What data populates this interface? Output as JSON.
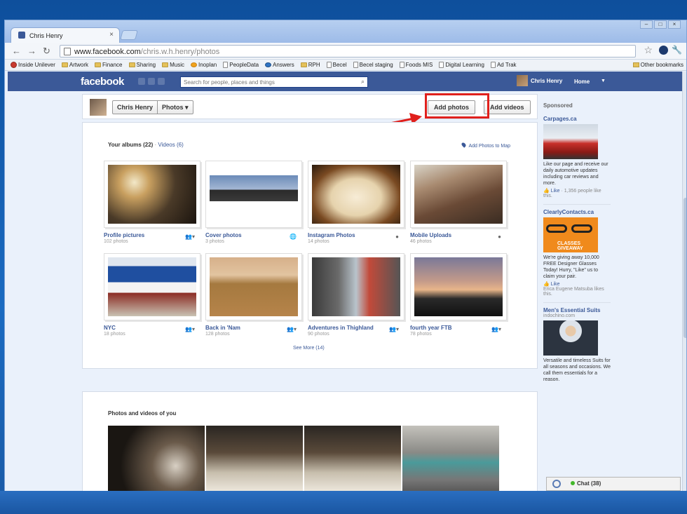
{
  "browser": {
    "tab_title": "Chris Henry",
    "url_host": "www.facebook.com",
    "url_path": "/chris.w.h.henry/photos",
    "bookmarks": [
      {
        "label": "Inside Unilever",
        "icon": "red-circle-icon"
      },
      {
        "label": "Artwork",
        "icon": "folder-icon"
      },
      {
        "label": "Finance",
        "icon": "folder-icon"
      },
      {
        "label": "Sharing",
        "icon": "folder-icon"
      },
      {
        "label": "Music",
        "icon": "folder-icon"
      },
      {
        "label": "Inoplan",
        "icon": "orange-circle-icon"
      },
      {
        "label": "PeopleData",
        "icon": "page-icon"
      },
      {
        "label": "Answers",
        "icon": "blue-circle-icon"
      },
      {
        "label": "RPH",
        "icon": "folder-icon"
      },
      {
        "label": "Becel",
        "icon": "page-icon"
      },
      {
        "label": "Becel staging",
        "icon": "page-icon"
      },
      {
        "label": "Foods MIS",
        "icon": "page-icon"
      },
      {
        "label": "Digital Learning",
        "icon": "page-icon"
      },
      {
        "label": "Ad Trak",
        "icon": "page-icon"
      }
    ],
    "other_bookmarks": "Other bookmarks"
  },
  "facebook": {
    "logo": "facebook",
    "search_placeholder": "Search for people, places and things",
    "user_name": "Chris Henry",
    "home": "Home"
  },
  "header": {
    "name": "Chris Henry",
    "section": "Photos ▾",
    "add_photos": "Add photos",
    "add_videos": "Add videos"
  },
  "albums": {
    "title": "Your albums (22)",
    "separator": " · ",
    "videos_link": "Videos (6)",
    "map_link": "Add Photos to Map",
    "items": [
      {
        "name": "Profile pictures",
        "count": "102 photos",
        "privacy": "👥▾"
      },
      {
        "name": "Cover photos",
        "count": "3 photos",
        "privacy": "🌐"
      },
      {
        "name": "Instagram Photos",
        "count": "14 photos",
        "privacy": "●"
      },
      {
        "name": "Mobile Uploads",
        "count": "46 photos",
        "privacy": "●"
      },
      {
        "name": "NYC",
        "count": "18 photos",
        "privacy": "👥▾"
      },
      {
        "name": "Back in 'Nam",
        "count": "128 photos",
        "privacy": "👥▾"
      },
      {
        "name": "Adventures in Thighland",
        "count": "90 photos",
        "privacy": "👥▾"
      },
      {
        "name": "fourth year FTB",
        "count": "78 photos",
        "privacy": "👥▾"
      }
    ],
    "see_more": "See More (14)"
  },
  "photos_of_you": {
    "title": "Photos and videos of you"
  },
  "sidebar": {
    "sponsored": "Sponsored",
    "ads": [
      {
        "title": "Carpages.ca",
        "sub": "",
        "text": "Like our page and receive our daily automotive updates including car reviews and more.",
        "like": "Like",
        "likes": "· 1,356 people like this."
      },
      {
        "title": "ClearlyContacts.ca",
        "sub": "",
        "text": "We're giving away 10,000 FREE Designer Glasses Today! Hurry, \"Like\" us to claim your pair.",
        "like": "Like",
        "likes": "Erica Eugene Matsuba likes this."
      },
      {
        "title": "Men's Essential Suits",
        "sub": "indochino.com",
        "text": "Versatile and timeless Suits for all seasons and occasions. We call them essentials for a reason.",
        "like": "",
        "likes": ""
      }
    ],
    "ad2_banner": "CLASSES GIVEAWAY"
  },
  "chat": {
    "label": "Chat (38)"
  },
  "colors": {
    "facebook_blue": "#3b5998",
    "highlight_red": "#e0201c",
    "link_blue": "#3b5998"
  }
}
